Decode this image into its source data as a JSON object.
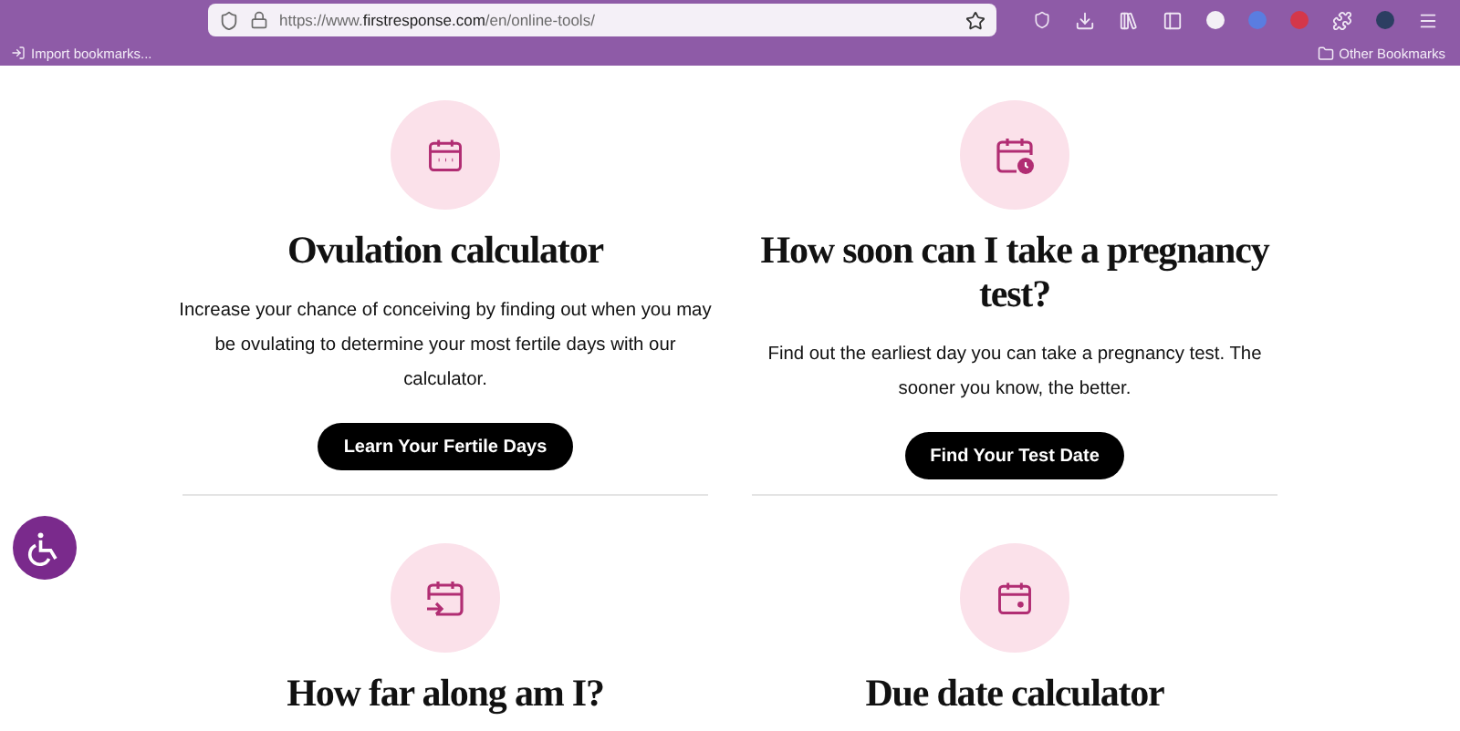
{
  "browser": {
    "url": "https://www.**firstresponse.com**/en/online-tools/",
    "bookmarks": [
      "Import bookmarks..."
    ],
    "other_bookmarks": "Other Bookmarks"
  },
  "tools": [
    {
      "kind": "calendar-dots",
      "title": "Ovulation calculator",
      "description": "Increase your chance of conceiving by finding out when you may be ovulating to determine your most fertile days with our calculator.",
      "button": "Learn Your Fertile Days"
    },
    {
      "kind": "calendar-clock",
      "title": "How soon can I take a pregnancy test?",
      "description": "Find out the earliest day you can take a pregnancy test. The sooner you know, the better.",
      "button": "Find Your Test Date"
    },
    {
      "kind": "calendar-arrow",
      "title": "How far along am I?"
    },
    {
      "kind": "calendar-dot",
      "title": "Due date calculator"
    }
  ]
}
